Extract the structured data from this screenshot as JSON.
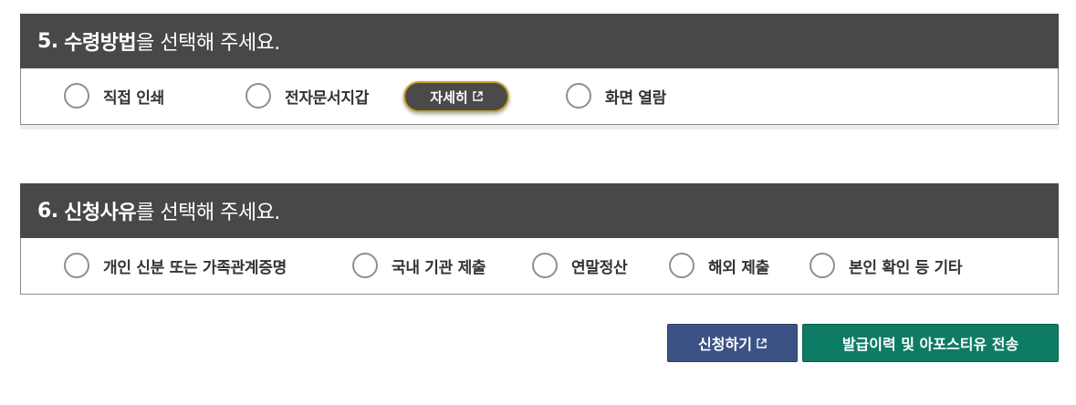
{
  "section5": {
    "number": "5.",
    "title_bold": "수령방법",
    "title_rest": "을 선택해 주세요.",
    "options": [
      {
        "label": "직접 인쇄",
        "selected": false
      },
      {
        "label": "전자문서지갑",
        "selected": false
      },
      {
        "label": "화면 열람",
        "selected": false
      }
    ],
    "detail_button": "자세히",
    "icon": "external-link-icon"
  },
  "section6": {
    "number": "6.",
    "title_bold": "신청사유",
    "title_rest": "를 선택해 주세요.",
    "options": [
      {
        "label": "개인 신분 또는 가족관계증명",
        "selected": false
      },
      {
        "label": "국내 기관 제출",
        "selected": false
      },
      {
        "label": "연말정산",
        "selected": false
      },
      {
        "label": "해외 제출",
        "selected": false
      },
      {
        "label": "본인 확인 등 기타",
        "selected": false
      }
    ]
  },
  "actions": {
    "apply_label": "신청하기",
    "send_label": "발급이력 및 아포스티유 전송"
  },
  "colors": {
    "header_bg": "#484848",
    "apply_bg": "#3c5285",
    "send_bg": "#0e7b64",
    "detail_border": "#c9a227"
  }
}
